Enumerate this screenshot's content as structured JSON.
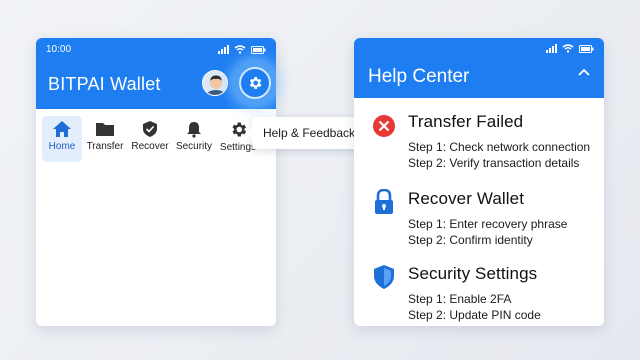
{
  "wallet": {
    "status_time": "10:00",
    "title": "BITPAI Wallet",
    "tooltip": "Help & Feedback",
    "nav": [
      {
        "label": "Home",
        "icon": "home-icon",
        "active": true
      },
      {
        "label": "Transfer",
        "icon": "folder-icon",
        "active": false
      },
      {
        "label": "Recover",
        "icon": "shield-check-icon",
        "active": false
      },
      {
        "label": "Security",
        "icon": "bell-icon",
        "active": false
      },
      {
        "label": "Settings",
        "icon": "gear-icon",
        "active": false
      }
    ]
  },
  "help": {
    "title": "Help Center",
    "sections": [
      {
        "title": "Transfer Failed",
        "icon": "error-x-icon",
        "steps": [
          "Step 1: Check network connection",
          "Step 2: Verify transaction details"
        ]
      },
      {
        "title": "Recover Wallet",
        "icon": "lock-icon",
        "steps": [
          "Step 1: Enter recovery phrase",
          "Step 2: Confirm identity"
        ]
      },
      {
        "title": "Security Settings",
        "icon": "shield-icon",
        "steps": [
          "Step 1: Enable 2FA",
          "Step 2: Update PIN code"
        ]
      }
    ]
  },
  "colors": {
    "brand": "#1e7ef1",
    "error": "#e53935",
    "nav_active_bg": "#e3eefc"
  }
}
